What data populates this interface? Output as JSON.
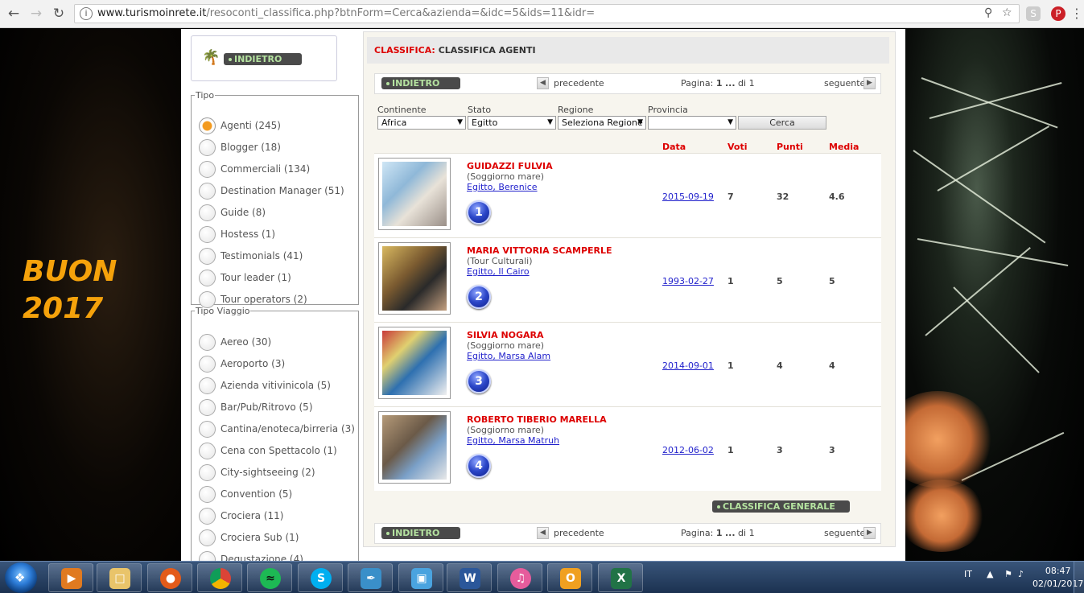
{
  "browser": {
    "url_host": "www.turismoinrete.it",
    "url_path": "/resoconti_classifica.php?btnForm=Cerca&azienda=&idc=5&ids=11&idr="
  },
  "banner": {
    "line1": "BUON",
    "line2": "2017"
  },
  "sidebar": {
    "back_label": "INDIETRO",
    "tipo": {
      "legend": "Tipo",
      "items": [
        {
          "label": "Agenti (245)",
          "checked": true
        },
        {
          "label": "Blogger (18)"
        },
        {
          "label": "Commerciali (134)"
        },
        {
          "label": "Destination Manager (51)"
        },
        {
          "label": "Guide (8)"
        },
        {
          "label": "Hostess (1)"
        },
        {
          "label": "Testimonials (41)"
        },
        {
          "label": "Tour leader (1)"
        },
        {
          "label": "Tour operators (2)"
        }
      ]
    },
    "tipo_viaggio": {
      "legend": "Tipo Viaggio",
      "items": [
        {
          "label": "Aereo (30)"
        },
        {
          "label": "Aeroporto (3)"
        },
        {
          "label": "Azienda vitivinicola (5)"
        },
        {
          "label": "Bar/Pub/Ritrovo (5)"
        },
        {
          "label": "Cantina/enoteca/birreria (3)"
        },
        {
          "label": "Cena con Spettacolo (1)"
        },
        {
          "label": "City-sightseeing (2)"
        },
        {
          "label": "Convention (5)"
        },
        {
          "label": "Crociera (11)"
        },
        {
          "label": "Crociera Sub (1)"
        },
        {
          "label": "Degustazione (4)"
        }
      ]
    }
  },
  "main": {
    "title_red": "CLASSIFICA:",
    "title_black": "CLASSIFICA AGENTI",
    "nav": {
      "back_label": "INDIETRO",
      "prev_label": "precedente",
      "page_prefix": "Pagina:",
      "page_current": "1",
      "page_sep": "...",
      "page_of": "di 1",
      "next_label": "seguente"
    },
    "filters": {
      "continente_label": "Continente",
      "continente_value": "Africa",
      "stato_label": "Stato",
      "stato_value": "Egitto",
      "regione_label": "Regione",
      "regione_value": "Seleziona Regione",
      "provincia_label": "Provincia",
      "provincia_value": "",
      "search_label": "Cerca"
    },
    "columns": {
      "data": "Data",
      "voti": "Voti",
      "punti": "Punti",
      "media": "Media"
    },
    "rows": [
      {
        "rank": "1",
        "name": "GUIDAZZI FULVIA",
        "type": "(Soggiorno mare)",
        "location": "Egitto, Berenice",
        "date": "2015-09-19",
        "voti": "7",
        "punti": "32",
        "media": "4.6"
      },
      {
        "rank": "2",
        "name": "MARIA VITTORIA SCAMPERLE",
        "type": "(Tour Culturali)",
        "location": "Egitto, Il Cairo",
        "date": "1993-02-27",
        "voti": "1",
        "punti": "5",
        "media": "5"
      },
      {
        "rank": "3",
        "name": "SILVIA NOGARA",
        "type": "(Soggiorno mare)",
        "location": "Egitto, Marsa Alam",
        "date": "2014-09-01",
        "voti": "1",
        "punti": "4",
        "media": "4"
      },
      {
        "rank": "4",
        "name": "ROBERTO TIBERIO MARELLA",
        "type": "(Soggiorno mare)",
        "location": "Egitto, Marsa Matruh",
        "date": "2012-06-02",
        "voti": "1",
        "punti": "3",
        "media": "3"
      }
    ],
    "general_label": "CLASSIFICA GENERALE"
  },
  "taskbar": {
    "lang": "IT",
    "time": "08:47",
    "date": "02/01/2017",
    "apps": [
      "media-player",
      "file-explorer",
      "firefox",
      "chrome",
      "spotify",
      "skype",
      "feather-app",
      "photos",
      "word",
      "itunes",
      "outlook",
      "excel"
    ]
  },
  "colors": {
    "accent_red": "#dd0000",
    "pill_bg": "#4a4a4a",
    "pill_text": "#b5e3a0",
    "banner_orange": "#f5a20b",
    "radio_on": "#f39a1e"
  }
}
